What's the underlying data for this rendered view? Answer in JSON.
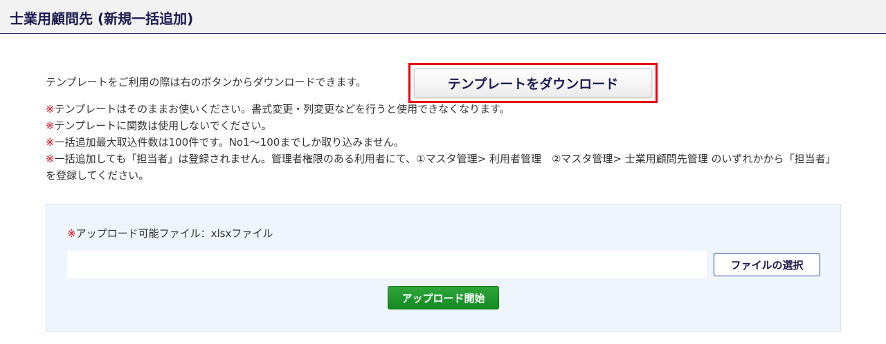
{
  "header": {
    "title": "士業用顧問先 (新規一括追加)"
  },
  "intro": {
    "text": "テンプレートをご利用の際は右のボタンからダウンロードできます。",
    "download_button_label": "テンプレートをダウンロード"
  },
  "notes": [
    {
      "mark": "※",
      "text": "テンプレートはそのままお使いください。書式変更・列変更などを行うと使用できなくなります。"
    },
    {
      "mark": "※",
      "text": "テンプレートに関数は使用しないでください。"
    },
    {
      "mark": "※",
      "text": "一括追加最大取込件数は100件です。No1～100までしか取り込みません。"
    },
    {
      "mark": "※",
      "text": "一括追加しても「担当者」は登録されません。管理者権限のある利用者にて、①マスタ管理> 利用者管理　②マスタ管理> 士業用顧問先管理 のいずれかから「担当者」を登録してください。"
    }
  ],
  "upload": {
    "label_mark": "※",
    "label_text": "アップロード可能ファイル：xlsxファイル",
    "file_value": "",
    "select_button_label": "ファイルの選択",
    "start_button_label": "アップロード開始"
  },
  "colors": {
    "accent_red": "#e60012",
    "title_navy": "#1a1a4e",
    "upload_green": "#1a9a2c",
    "panel_bg": "#eef5fc"
  }
}
